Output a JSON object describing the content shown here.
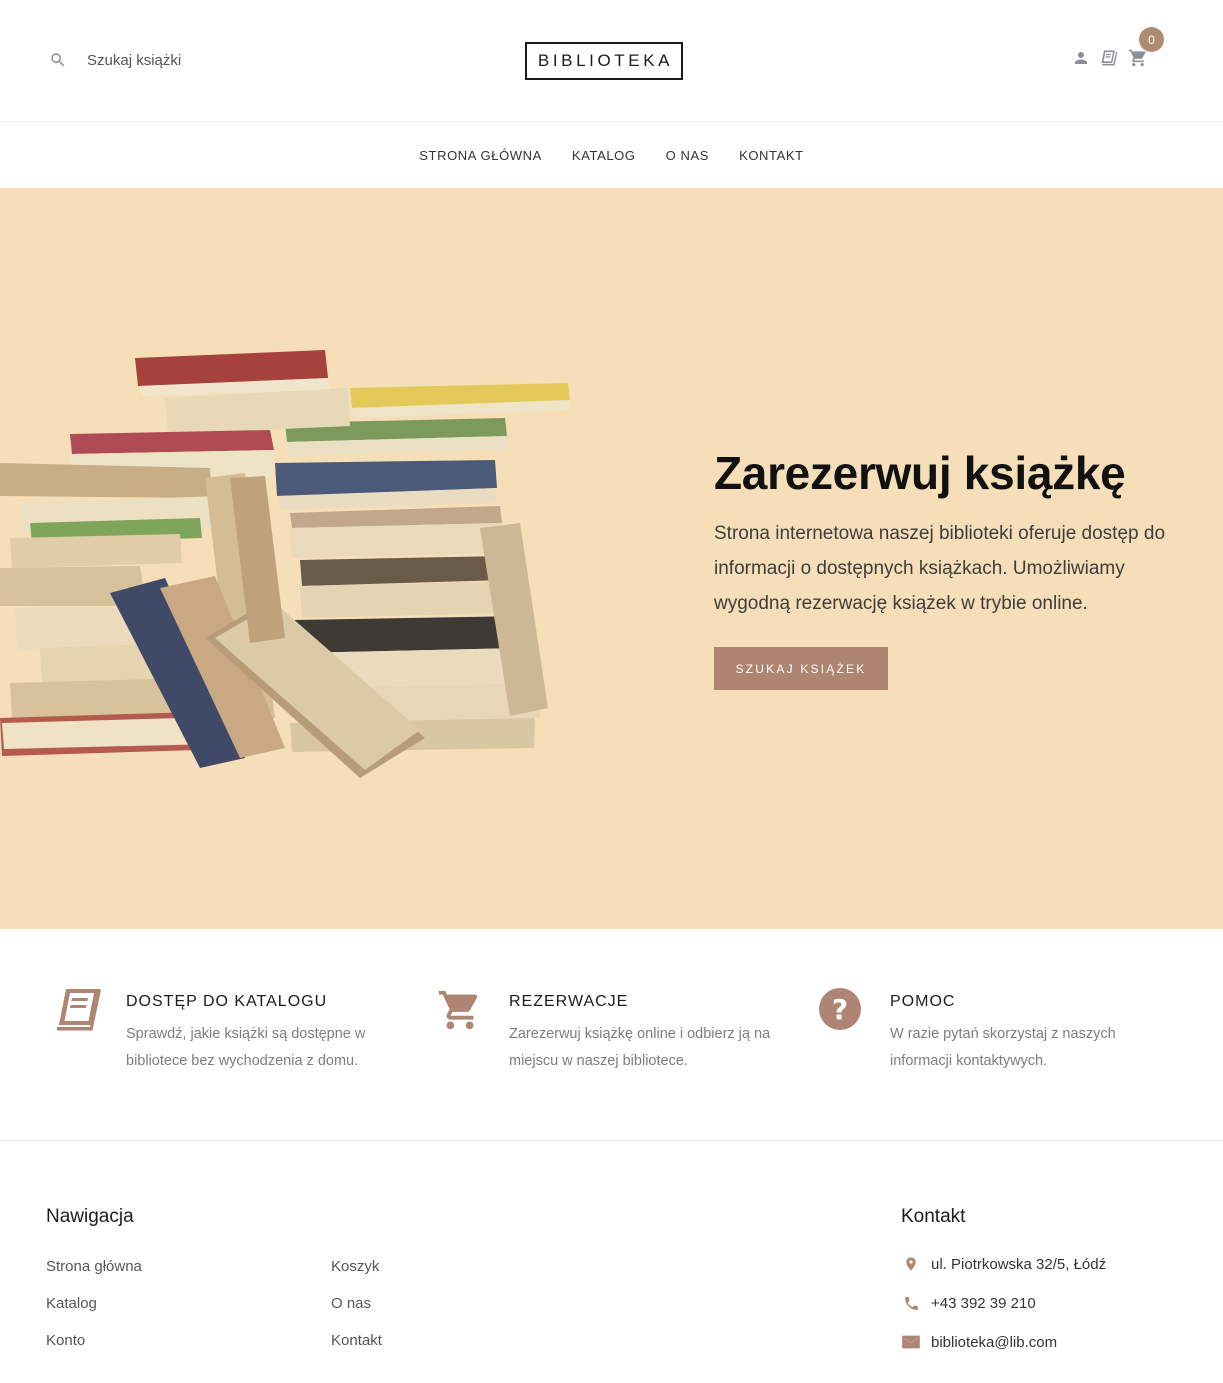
{
  "header": {
    "search_placeholder": "Szukaj książki",
    "logo": "BIBLIOTEKA",
    "cart_count": "0",
    "icons": [
      "search-icon",
      "user-icon",
      "book-icon",
      "cart-icon"
    ]
  },
  "nav": {
    "items": [
      {
        "label": "STRONA GŁÓWNA"
      },
      {
        "label": "KATALOG"
      },
      {
        "label": "O NAS"
      },
      {
        "label": "KONTAKT"
      }
    ]
  },
  "hero": {
    "title": "Zarezerwuj książkę",
    "description": "Strona internetowa naszej biblioteki oferuje dostęp do informacji o dostępnych książkach. Umożliwiamy wygodną rezerwację książek w trybie online.",
    "button": "SZUKAJ KSIĄŻEK"
  },
  "features": [
    {
      "icon": "book-icon",
      "title": "DOSTĘP DO KATALOGU",
      "text": "Sprawdź, jakie książki są dostępne w bibliotece bez wychodzenia z domu."
    },
    {
      "icon": "cart-icon",
      "title": "REZERWACJE",
      "text": "Zarezerwuj książkę online i odbierz ją na miejscu w naszej bibliotece."
    },
    {
      "icon": "help-icon",
      "title": "POMOC",
      "text": "W razie pytań skorzystaj z naszych informacji kontaktywych."
    }
  ],
  "footer": {
    "nav_title": "Nawigacja",
    "links_col1": [
      "Strona główna",
      "Katalog",
      "Konto"
    ],
    "links_col2": [
      "Koszyk",
      "O nas",
      "Kontakt"
    ],
    "contact_title": "Kontakt",
    "address": "ul. Piotrkowska 32/5, Łódź",
    "phone": "+43 392 39 210",
    "email": "biblioteka@lib.com"
  },
  "colors": {
    "accent": "#ae8472",
    "hero_bg": "#f6deb9",
    "icon_gray": "#8a8f99"
  }
}
